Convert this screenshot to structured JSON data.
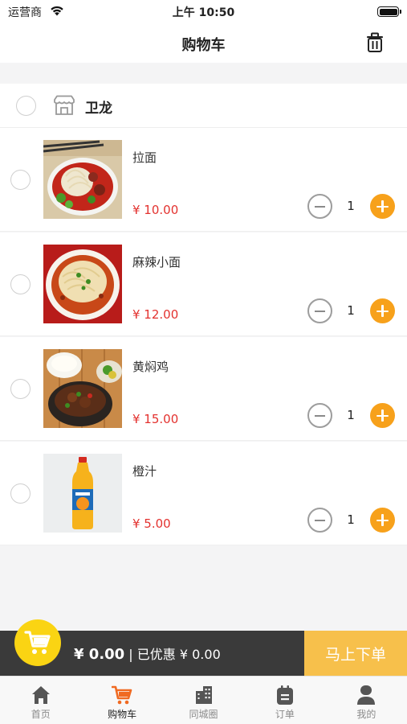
{
  "status_bar": {
    "carrier": "运营商",
    "time": "上午 10:50"
  },
  "header": {
    "title": "购物车"
  },
  "shop": {
    "name": "卫龙"
  },
  "items": [
    {
      "name": "拉面",
      "price": "¥ 10.00",
      "quantity": "1"
    },
    {
      "name": "麻辣小面",
      "price": "¥ 12.00",
      "quantity": "1"
    },
    {
      "name": "黄焖鸡",
      "price": "¥ 15.00",
      "quantity": "1"
    },
    {
      "name": "橙汁",
      "price": "¥ 5.00",
      "quantity": "1"
    }
  ],
  "checkout": {
    "total": "¥ 0.00",
    "discount_text": "| 已优惠 ¥ 0.00",
    "button_label": "马上下单"
  },
  "tabs": [
    {
      "label": "首页",
      "icon": "home-icon"
    },
    {
      "label": "购物车",
      "icon": "cart-icon",
      "active": true
    },
    {
      "label": "同城圈",
      "icon": "building-icon"
    },
    {
      "label": "订单",
      "icon": "order-icon"
    },
    {
      "label": "我的",
      "icon": "user-icon"
    }
  ],
  "colors": {
    "accent": "#f7a11b",
    "price": "#e3322f",
    "checkout_button": "#f7c04b",
    "cart_fab": "#fad413",
    "active_tab": "#f06a22"
  }
}
